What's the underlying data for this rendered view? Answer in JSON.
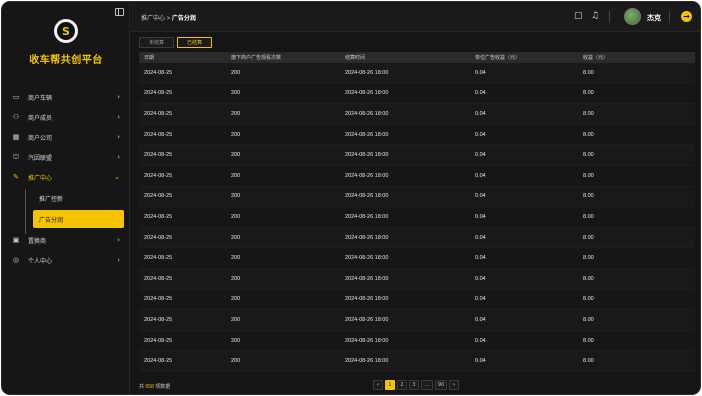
{
  "sidebar": {
    "brand": "收车帮共创平台",
    "logo_text": "S",
    "items": [
      {
        "label": "商户车辆",
        "icon": "car-icon",
        "glyph": "▭",
        "chev": "›"
      },
      {
        "label": "商户成员",
        "icon": "members-icon",
        "glyph": "⚇",
        "chev": "›"
      },
      {
        "label": "商户公司",
        "icon": "building-icon",
        "glyph": "▦",
        "chev": "›"
      },
      {
        "label": "汽因联盟",
        "icon": "alliance-icon",
        "glyph": "⛫",
        "chev": "›"
      },
      {
        "label": "推广中心",
        "icon": "promo-icon",
        "glyph": "✎",
        "chev": "⌄"
      }
    ],
    "sub_items": [
      {
        "label": "推广控新"
      },
      {
        "label": "广告分润"
      }
    ],
    "items_after": [
      {
        "label": "置换商",
        "icon": "exchange-icon",
        "glyph": "▣",
        "chev": "›"
      },
      {
        "label": "个人中心",
        "icon": "user-center-icon",
        "glyph": "◎",
        "chev": "›"
      }
    ]
  },
  "header": {
    "breadcrumb_parent": "推广中心",
    "breadcrumb_sep": ">",
    "breadcrumb_current": "广告分润",
    "username": "杰克",
    "message_glyph": "▢",
    "bell_glyph": "♫",
    "logout_glyph": "→"
  },
  "tabs": [
    {
      "label": "未结算",
      "active": false
    },
    {
      "label": "已结算",
      "active": true
    }
  ],
  "table": {
    "columns": [
      "日期",
      "旗下商户广告观看次数",
      "结算时间",
      "单位广告收益（元）",
      "收益（元）"
    ],
    "rows": [
      [
        "2024-08-25",
        "200",
        "2024-08-26  18:00",
        "0.04",
        "8.00"
      ],
      [
        "2024-08-25",
        "200",
        "2024-08-26  18:00",
        "0.04",
        "8.00"
      ],
      [
        "2024-08-25",
        "200",
        "2024-08-26  18:00",
        "0.04",
        "8.00"
      ],
      [
        "2024-08-25",
        "200",
        "2024-08-26  18:00",
        "0.04",
        "8.00"
      ],
      [
        "2024-08-25",
        "200",
        "2024-08-26  18:00",
        "0.04",
        "8.00"
      ],
      [
        "2024-08-25",
        "200",
        "2024-08-26  18:00",
        "0.04",
        "8.00"
      ],
      [
        "2024-08-25",
        "200",
        "2024-08-26  18:00",
        "0.04",
        "8.00"
      ],
      [
        "2024-08-25",
        "200",
        "2024-08-26  18:00",
        "0.04",
        "8.00"
      ],
      [
        "2024-08-25",
        "200",
        "2024-08-26  18:00",
        "0.04",
        "8.00"
      ],
      [
        "2024-08-25",
        "200",
        "2024-08-26  18:00",
        "0.04",
        "8.00"
      ],
      [
        "2024-08-25",
        "200",
        "2024-08-26  18:00",
        "0.04",
        "8.00"
      ],
      [
        "2024-08-25",
        "200",
        "2024-08-26  18:00",
        "0.04",
        "8.00"
      ],
      [
        "2024-08-25",
        "200",
        "2024-08-26  18:00",
        "0.04",
        "8.00"
      ],
      [
        "2024-08-25",
        "200",
        "2024-08-26  18:00",
        "0.04",
        "8.00"
      ],
      [
        "2024-08-25",
        "200",
        "2024-08-26  18:00",
        "0.04",
        "8.00"
      ]
    ]
  },
  "footer": {
    "count_prefix": "共",
    "count": "658",
    "count_suffix": "项数据"
  },
  "pagination": {
    "prev": "‹",
    "pages": [
      "1",
      "2",
      "3",
      "...",
      "90"
    ],
    "current": "1",
    "next": "›"
  },
  "colors": {
    "accent": "#f5c400",
    "background": "#151515",
    "table_header": "#2b2b2b"
  }
}
